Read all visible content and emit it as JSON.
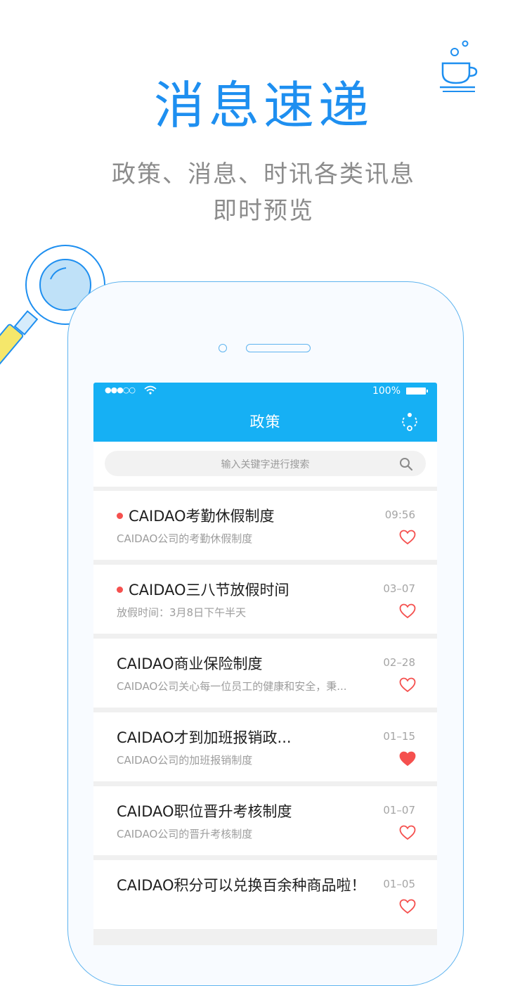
{
  "promo": {
    "headline": "消息速递",
    "subline1": "政策、消息、时讯各类讯息",
    "subline2": "即时预览"
  },
  "colors": {
    "accent": "#1e8ff0",
    "navbar": "#16b0f4",
    "unread_dot": "#f5504e",
    "heart": "#f5504e"
  },
  "statusbar": {
    "signal": "●●●○○",
    "battery": "100%"
  },
  "navbar": {
    "title": "政策",
    "action_icon": "refresh-people-icon"
  },
  "search": {
    "placeholder": "输入关键字进行搜索"
  },
  "items": [
    {
      "title": "CAIDAO考勤休假制度",
      "subtitle": "CAIDAO公司的考勤休假制度",
      "date": "09:56",
      "unread": true,
      "favorited": false
    },
    {
      "title": "CAIDAO三八节放假时间",
      "subtitle": "放假时间：3月8日下午半天",
      "date": "03–07",
      "unread": true,
      "favorited": false
    },
    {
      "title": "CAIDAO商业保险制度",
      "subtitle": "CAIDAO公司关心每一位员工的健康和安全，秉...",
      "date": "02–28",
      "unread": false,
      "favorited": false
    },
    {
      "title": "CAIDAO才到加班报销政...",
      "subtitle": "CAIDAO公司的加班报销制度",
      "date": "01–15",
      "unread": false,
      "favorited": true
    },
    {
      "title": "CAIDAO职位晋升考核制度",
      "subtitle": "CAIDAO公司的晋升考核制度",
      "date": "01–07",
      "unread": false,
      "favorited": false
    },
    {
      "title": "CAIDAO积分可以兑换百余种商品啦！",
      "subtitle": "",
      "date": "01–05",
      "unread": false,
      "favorited": false
    }
  ]
}
